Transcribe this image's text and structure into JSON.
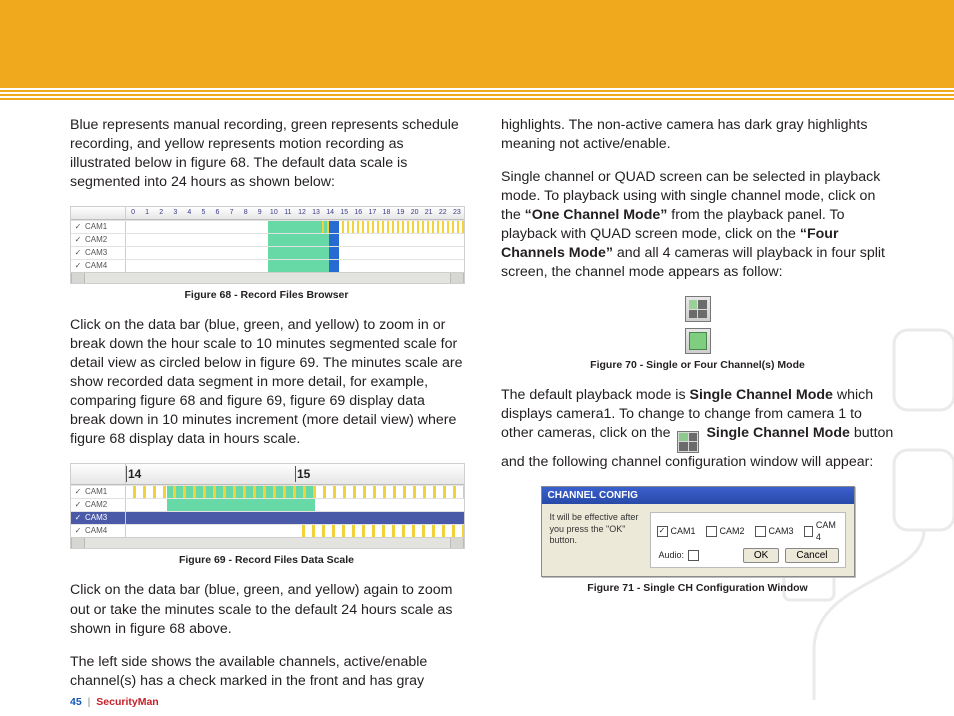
{
  "header": {
    "banner_color": "#f0a91c"
  },
  "left": {
    "p1": "Blue represents manual recording, green represents schedule recording, and yellow represents motion recording as illustrated below in figure 68.  The default data scale is segmented into 24 hours as shown below:",
    "fig68": {
      "caption": "Figure 68 - Record Files Browser",
      "hours": [
        "0",
        "1",
        "2",
        "3",
        "4",
        "5",
        "6",
        "7",
        "8",
        "9",
        "10",
        "11",
        "12",
        "13",
        "14",
        "15",
        "16",
        "17",
        "18",
        "19",
        "20",
        "21",
        "22",
        "23"
      ],
      "channels": [
        "CAM1",
        "CAM2",
        "CAM3",
        "CAM4"
      ]
    },
    "p2": "Click on the data bar (blue, green, and yellow) to zoom in or break down the hour scale to 10 minutes segmented scale for detail view as circled below in figure 69.  The minutes scale are show recorded data segment in more detail, for example, comparing figure 68 and figure 69, figure 69 display data break down in 10 minutes increment (more detail view) where figure 68 display data in hours scale.",
    "fig69": {
      "caption": "Figure 69 - Record Files Data Scale",
      "bigticks": [
        "14",
        "15"
      ],
      "channels": [
        "CAM1",
        "CAM2",
        "CAM3",
        "CAM4"
      ]
    },
    "p3": "Click on the data bar (blue, green, and yellow) again to zoom out or take the minutes scale to the default 24 hours scale as shown in figure 68 above.",
    "p4": "The left side shows the available channels, active/enable channel(s) has a check marked in the front and has gray"
  },
  "right": {
    "p1": "highlights.  The non-active camera has dark gray highlights meaning not active/enable.",
    "p2a": "Single channel or QUAD screen can be selected in playback mode.  To playback using with single channel mode, click on the ",
    "p2b_bold": "“One Channel Mode”",
    "p2c": " from the playback panel.  To playback with QUAD screen mode, click on the ",
    "p2d_bold": "“Four Channels Mode”",
    "p2e": " and all 4 cameras will playback in four split screen, the channel mode appears as follow:",
    "fig70_caption": "Figure 70 - Single or Four Channel(s) Mode",
    "p3a": "The default playback mode is ",
    "p3b_bold": "Single Channel Mode",
    "p3c": " which displays camera1. To change to change from camera 1 to other cameras, click on the ",
    "p3d_bold": " Single Channel Mode",
    "p3e": " button and the following channel configuration window will appear:",
    "dialog": {
      "title": "CHANNEL CONFIG",
      "note": "It will be effective after you press the \"OK\" button.",
      "cams": [
        "CAM1",
        "CAM2",
        "CAM3",
        "CAM 4"
      ],
      "checked_index": 0,
      "audio_label": "Audio:",
      "ok": "OK",
      "cancel": "Cancel"
    },
    "fig71_caption": "Figure 71 - Single CH Configuration Window"
  },
  "footer": {
    "page": "45",
    "separator": "|",
    "brand": "SecurityMan"
  }
}
